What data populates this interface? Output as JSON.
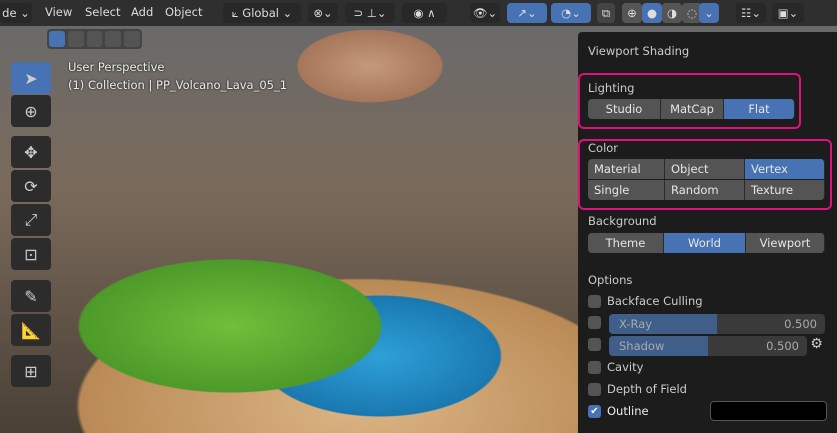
{
  "header": {
    "mode_label": "de",
    "menus": [
      "View",
      "Select",
      "Add",
      "Object"
    ],
    "transform_orientation": "Global"
  },
  "viewport": {
    "perspective": "User Perspective",
    "collection": "(1) Collection | PP_Volcano_Lava_05_1"
  },
  "shading_popover": {
    "title": "Viewport Shading",
    "lighting": {
      "label": "Lighting",
      "options": [
        "Studio",
        "MatCap",
        "Flat"
      ],
      "selected": "Flat"
    },
    "color": {
      "label": "Color",
      "options": [
        "Material",
        "Object",
        "Vertex",
        "Single",
        "Random",
        "Texture"
      ],
      "selected": "Vertex"
    },
    "background": {
      "label": "Background",
      "options": [
        "Theme",
        "World",
        "Viewport"
      ],
      "selected": "World"
    },
    "options": {
      "label": "Options",
      "backface_culling": {
        "label": "Backface Culling",
        "checked": false
      },
      "xray": {
        "label": "X-Ray",
        "value": "0.500",
        "fraction": 0.5,
        "checked": false
      },
      "shadow": {
        "label": "Shadow",
        "value": "0.500",
        "fraction": 0.5,
        "checked": false
      },
      "cavity": {
        "label": "Cavity",
        "checked": false
      },
      "depth_of_field": {
        "label": "Depth of Field",
        "checked": false
      },
      "outline": {
        "label": "Outline",
        "checked": true,
        "color": "#000000"
      }
    }
  },
  "colors": {
    "accent": "#4772b3",
    "highlight": "#e0107f"
  }
}
